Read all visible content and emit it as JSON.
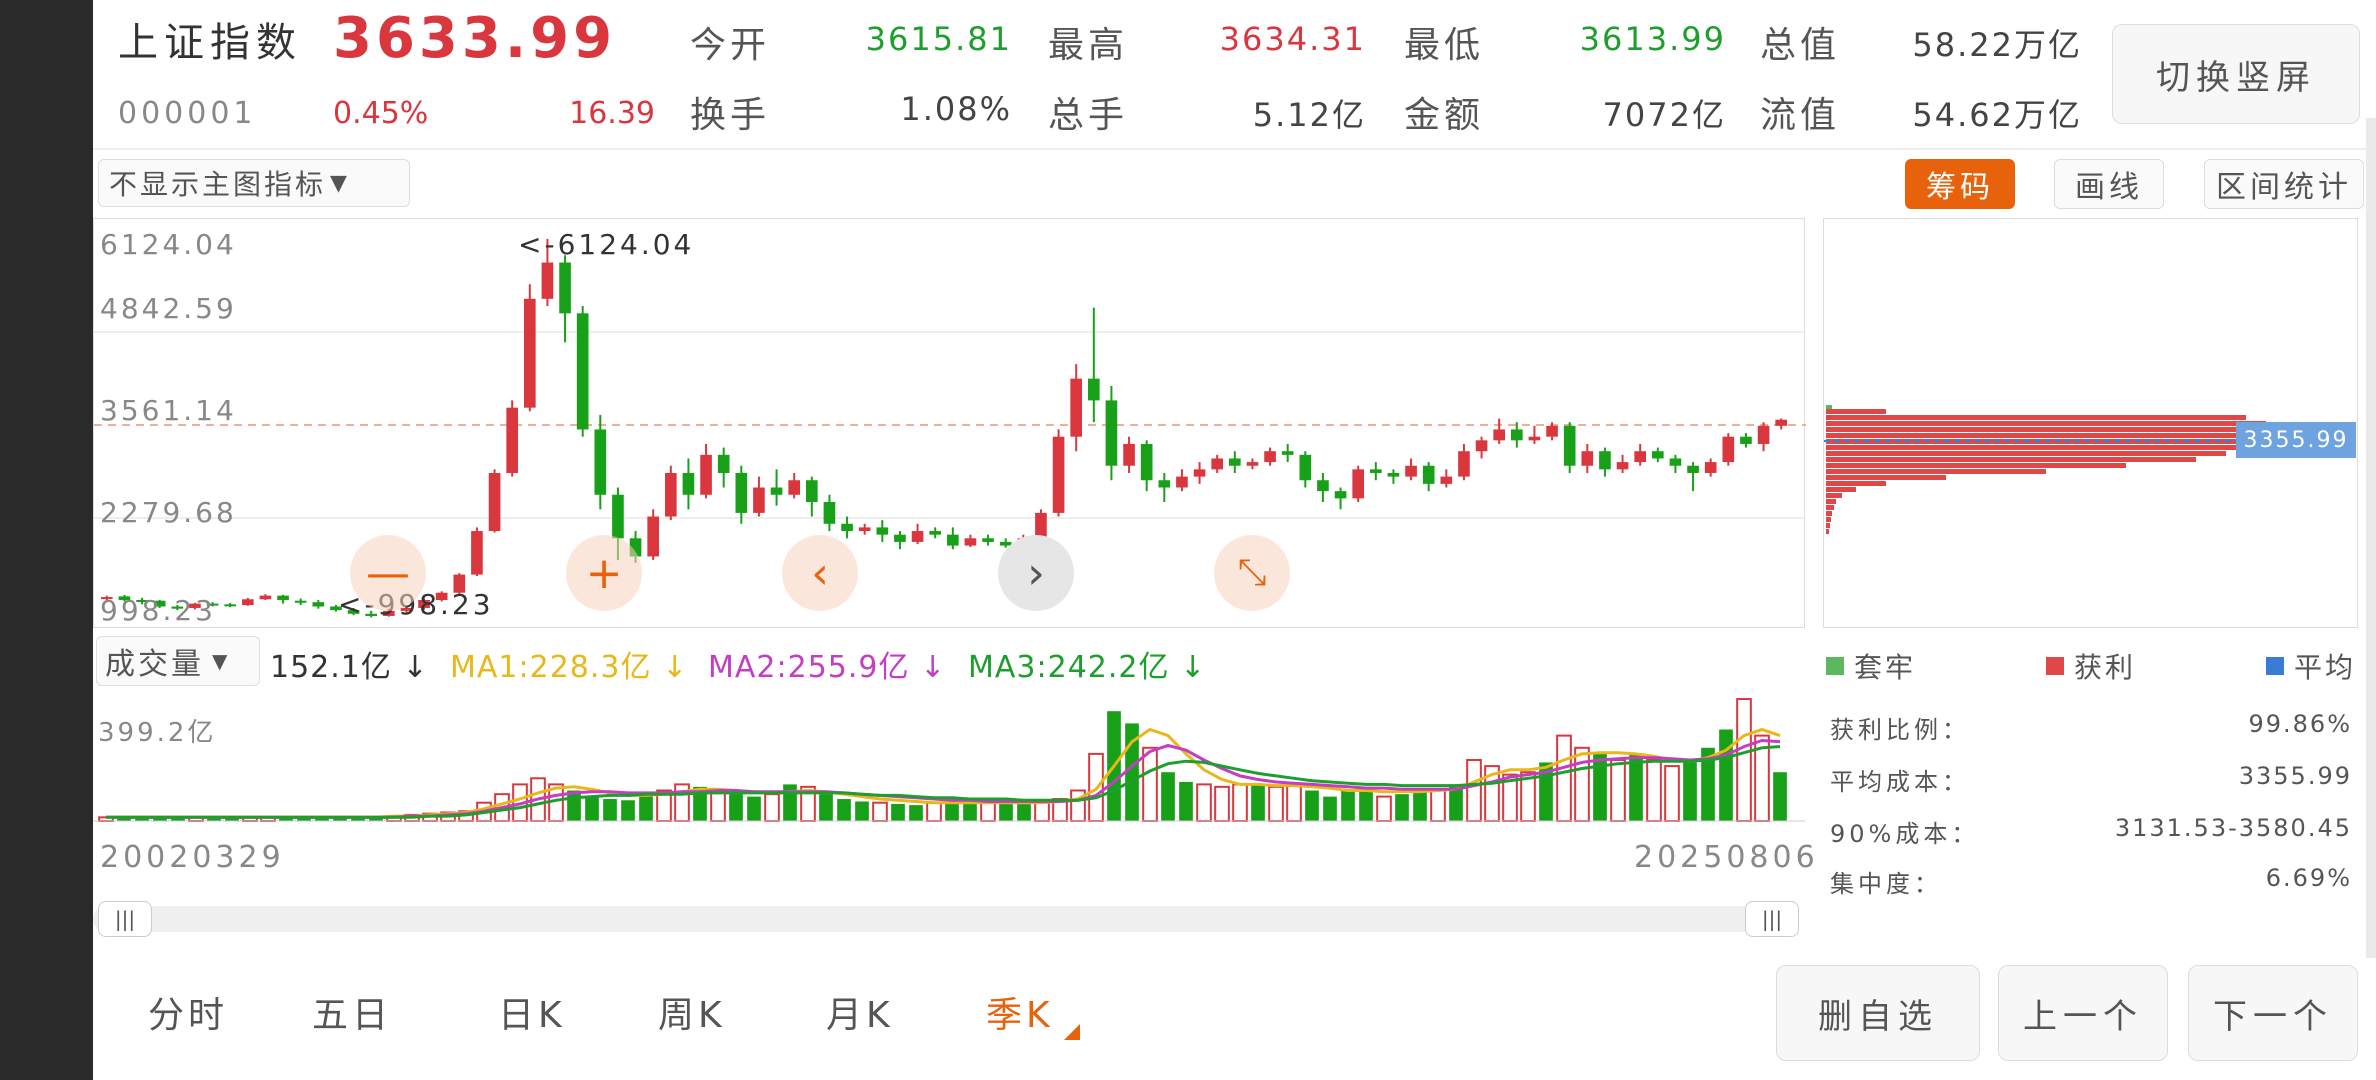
{
  "header": {
    "index_name": "上证指数",
    "index_price": "3633.99",
    "index_code": "000001",
    "change_pct": "0.45%",
    "change_val": "16.39",
    "open_label": "今开",
    "open_val": "3615.81",
    "high_label": "最高",
    "high_val": "3634.31",
    "low_label": "最低",
    "low_val": "3613.99",
    "total_cap_label": "总值",
    "total_cap_val": "58.22万亿",
    "turnover_label": "换手",
    "turnover_val": "1.08%",
    "hands_label": "总手",
    "hands_val": "5.12亿",
    "amount_label": "金额",
    "amount_val": "7072亿",
    "float_cap_label": "流值",
    "float_cap_val": "54.62万亿",
    "switch_button": "切换竖屏"
  },
  "toolbar": {
    "main_indicator": "不显示主图指标",
    "chip_button": "筹码",
    "draw_button": "画线",
    "range_button": "区间统计"
  },
  "kline": {
    "y_labels": [
      "6124.04",
      "4842.59",
      "3561.14",
      "2279.68",
      "998.23"
    ],
    "max_marker": "<-6124.04",
    "min_marker": "<-998.23",
    "candles": [
      [
        1180,
        1190,
        1120,
        1210
      ],
      [
        1200,
        1150,
        1130,
        1220
      ],
      [
        1150,
        1140,
        1090,
        1180
      ],
      [
        1140,
        1060,
        1040,
        1150
      ],
      [
        1060,
        1030,
        1010,
        1080
      ],
      [
        1040,
        1100,
        1020,
        1110
      ],
      [
        1100,
        1090,
        1060,
        1120
      ],
      [
        1090,
        1080,
        1050,
        1110
      ],
      [
        1080,
        1160,
        1070,
        1180
      ],
      [
        1160,
        1210,
        1150,
        1230
      ],
      [
        1210,
        1150,
        1100,
        1220
      ],
      [
        1140,
        1120,
        1080,
        1170
      ],
      [
        1120,
        1060,
        1030,
        1150
      ],
      [
        1060,
        1010,
        990,
        1080
      ],
      [
        1010,
        960,
        940,
        1040
      ],
      [
        960,
        930,
        910,
        1000
      ],
      [
        930,
        1000,
        920,
        1030
      ],
      [
        1000,
        1040,
        980,
        1060
      ],
      [
        1040,
        1150,
        1020,
        1170
      ],
      [
        1150,
        1250,
        1130,
        1270
      ],
      [
        1250,
        1500,
        1230,
        1520
      ],
      [
        1500,
        2100,
        1480,
        2150
      ],
      [
        2100,
        2900,
        2080,
        2950
      ],
      [
        2900,
        3800,
        2850,
        3900
      ],
      [
        3800,
        5300,
        3750,
        5500
      ],
      [
        5300,
        5800,
        5200,
        6124
      ],
      [
        5800,
        5100,
        4700,
        5900
      ],
      [
        5100,
        3500,
        3400,
        5200
      ],
      [
        3500,
        2600,
        2400,
        3700
      ],
      [
        2600,
        2000,
        1700,
        2700
      ],
      [
        2000,
        1750,
        1664,
        2100
      ],
      [
        1750,
        2300,
        1700,
        2400
      ],
      [
        2300,
        2900,
        2250,
        3000
      ],
      [
        2900,
        2600,
        2400,
        3100
      ],
      [
        2600,
        3150,
        2550,
        3300
      ],
      [
        3150,
        2900,
        2700,
        3250
      ],
      [
        2900,
        2350,
        2200,
        3000
      ],
      [
        2350,
        2700,
        2300,
        2850
      ],
      [
        2700,
        2600,
        2450,
        2950
      ],
      [
        2600,
        2800,
        2550,
        2900
      ],
      [
        2800,
        2500,
        2300,
        2850
      ],
      [
        2500,
        2200,
        2100,
        2600
      ],
      [
        2200,
        2100,
        2000,
        2300
      ],
      [
        2100,
        2150,
        2050,
        2200
      ],
      [
        2150,
        2050,
        1950,
        2250
      ],
      [
        2050,
        1950,
        1850,
        2100
      ],
      [
        1950,
        2100,
        1920,
        2200
      ],
      [
        2100,
        2050,
        2000,
        2150
      ],
      [
        2050,
        1900,
        1850,
        2150
      ],
      [
        1900,
        2000,
        1880,
        2050
      ],
      [
        2000,
        1950,
        1900,
        2050
      ],
      [
        1950,
        1900,
        1870,
        2000
      ],
      [
        1900,
        2000,
        1880,
        2050
      ],
      [
        2000,
        2350,
        1980,
        2400
      ],
      [
        2350,
        3400,
        2300,
        3500
      ],
      [
        3400,
        4200,
        3200,
        4400
      ],
      [
        4200,
        3900,
        3600,
        5178
      ],
      [
        3900,
        3000,
        2800,
        4100
      ],
      [
        3000,
        3300,
        2900,
        3400
      ],
      [
        3300,
        2800,
        2650,
        3350
      ],
      [
        2800,
        2700,
        2500,
        2900
      ],
      [
        2700,
        2850,
        2650,
        2950
      ],
      [
        2850,
        2950,
        2750,
        3050
      ],
      [
        2950,
        3100,
        2900,
        3150
      ],
      [
        3100,
        3000,
        2900,
        3200
      ],
      [
        3000,
        3050,
        2950,
        3100
      ],
      [
        3050,
        3200,
        3000,
        3250
      ],
      [
        3200,
        3150,
        3050,
        3300
      ],
      [
        3150,
        2800,
        2700,
        3200
      ],
      [
        2800,
        2650,
        2500,
        2900
      ],
      [
        2650,
        2550,
        2400,
        2700
      ],
      [
        2550,
        2950,
        2500,
        3000
      ],
      [
        2950,
        2900,
        2800,
        3050
      ],
      [
        2900,
        2850,
        2750,
        2950
      ],
      [
        2850,
        3000,
        2800,
        3100
      ],
      [
        3000,
        2750,
        2650,
        3050
      ],
      [
        2750,
        2850,
        2700,
        2950
      ],
      [
        2850,
        3200,
        2800,
        3300
      ],
      [
        3200,
        3350,
        3100,
        3400
      ],
      [
        3350,
        3500,
        3300,
        3650
      ],
      [
        3500,
        3350,
        3250,
        3600
      ],
      [
        3350,
        3400,
        3300,
        3550
      ],
      [
        3400,
        3550,
        3350,
        3600
      ],
      [
        3550,
        3000,
        2900,
        3600
      ],
      [
        3000,
        3200,
        2900,
        3300
      ],
      [
        3200,
        2950,
        2850,
        3250
      ],
      [
        2950,
        3050,
        2900,
        3150
      ],
      [
        3050,
        3200,
        3000,
        3300
      ],
      [
        3200,
        3100,
        3050,
        3250
      ],
      [
        3100,
        3000,
        2900,
        3150
      ],
      [
        3000,
        2900,
        2650,
        3050
      ],
      [
        2900,
        3050,
        2850,
        3100
      ],
      [
        3050,
        3400,
        3000,
        3450
      ],
      [
        3400,
        3300,
        3250,
        3450
      ],
      [
        3300,
        3550,
        3200,
        3600
      ],
      [
        3550,
        3634,
        3500,
        3650
      ]
    ]
  },
  "controls": {
    "zoom_out": "—",
    "zoom_in": "+",
    "left": "‹",
    "right": "›",
    "fit": "⤡"
  },
  "volume": {
    "selector": "成交量",
    "current": "152.1亿 ↓",
    "ma1": "MA1:228.3亿 ↓",
    "ma2": "MA2:255.9亿 ↓",
    "ma3": "MA3:242.2亿 ↓",
    "max_label": "399.2亿",
    "start_date": "20020329",
    "end_date": "20250806",
    "bars": [
      3,
      3,
      3,
      3,
      3,
      3,
      3,
      3,
      3,
      3,
      3,
      3,
      3,
      3,
      3,
      4,
      4,
      5,
      6,
      7,
      8,
      15,
      22,
      30,
      35,
      30,
      25,
      20,
      18,
      17,
      22,
      25,
      30,
      28,
      25,
      22,
      20,
      22,
      30,
      28,
      22,
      18,
      16,
      15,
      14,
      13,
      15,
      14,
      17,
      16,
      15,
      14,
      16,
      18,
      25,
      55,
      90,
      80,
      60,
      40,
      32,
      30,
      28,
      30,
      30,
      28,
      30,
      25,
      20,
      25,
      28,
      20,
      22,
      25,
      26,
      30,
      50,
      45,
      38,
      40,
      48,
      70,
      60,
      55,
      50,
      55,
      50,
      45,
      48,
      60,
      75,
      100,
      70,
      40
    ],
    "ma1_pts": [
      3,
      3,
      3,
      3,
      3,
      3,
      3,
      3,
      3,
      3,
      3,
      3,
      3,
      3,
      3,
      3,
      4,
      4,
      5,
      6,
      7,
      10,
      14,
      18,
      23,
      27,
      28,
      26,
      23,
      21,
      21,
      22,
      24,
      26,
      26,
      25,
      24,
      23,
      24,
      25,
      24,
      22,
      20,
      18,
      17,
      16,
      15,
      15,
      15,
      15,
      15,
      15,
      15,
      16,
      18,
      26,
      45,
      65,
      75,
      70,
      55,
      42,
      34,
      30,
      30,
      29,
      29,
      28,
      27,
      25,
      25,
      24,
      24,
      24,
      25,
      26,
      32,
      38,
      42,
      42,
      44,
      50,
      55,
      56,
      56,
      55,
      53,
      50,
      49,
      52,
      58,
      70,
      75,
      70
    ],
    "ma2_pts": [
      3,
      3,
      3,
      3,
      3,
      3,
      3,
      3,
      3,
      3,
      3,
      3,
      3,
      3,
      3,
      3,
      3,
      4,
      4,
      5,
      6,
      8,
      11,
      14,
      18,
      21,
      23,
      24,
      24,
      23,
      23,
      23,
      24,
      24,
      25,
      25,
      24,
      24,
      24,
      24,
      24,
      23,
      22,
      21,
      20,
      19,
      18,
      17,
      17,
      16,
      16,
      16,
      16,
      16,
      17,
      21,
      32,
      45,
      57,
      62,
      58,
      50,
      43,
      37,
      34,
      32,
      31,
      30,
      29,
      28,
      27,
      27,
      26,
      26,
      26,
      26,
      29,
      32,
      36,
      38,
      40,
      44,
      48,
      50,
      51,
      52,
      52,
      51,
      50,
      51,
      54,
      61,
      66,
      65
    ],
    "ma3_pts": [
      3,
      3,
      3,
      3,
      3,
      3,
      3,
      3,
      3,
      3,
      3,
      3,
      3,
      3,
      3,
      3,
      3,
      3,
      4,
      4,
      5,
      7,
      9,
      11,
      14,
      17,
      19,
      20,
      21,
      21,
      22,
      22,
      22,
      23,
      23,
      23,
      23,
      23,
      23,
      23,
      23,
      23,
      22,
      21,
      21,
      20,
      19,
      19,
      18,
      18,
      18,
      17,
      17,
      17,
      17,
      19,
      25,
      33,
      41,
      47,
      49,
      48,
      45,
      42,
      39,
      37,
      35,
      33,
      32,
      31,
      30,
      30,
      29,
      29,
      29,
      29,
      30,
      31,
      33,
      35,
      37,
      40,
      43,
      45,
      47,
      48,
      49,
      49,
      49,
      50,
      52,
      56,
      60,
      61
    ]
  },
  "chip": {
    "avg_price_label": "3355.99",
    "legend_trapped": "套牢",
    "legend_profit": "获利",
    "legend_avg": "平均",
    "color_trapped": "#5cb85c",
    "color_profit": "#e04848",
    "color_avg": "#3a7bd5",
    "stats": [
      {
        "label": "获利比例：",
        "value": "99.86%"
      },
      {
        "label": "平均成本：",
        "value": "3355.99"
      },
      {
        "label": "90%成本：",
        "value": "3131.53-3580.45"
      },
      {
        "label": "集中度：",
        "value": "6.69%"
      }
    ]
  },
  "periods": [
    "分时",
    "五日",
    "日K",
    "周K",
    "月K",
    "季K"
  ],
  "nav": {
    "remove_fav": "删自选",
    "prev": "上一个",
    "next": "下一个"
  }
}
